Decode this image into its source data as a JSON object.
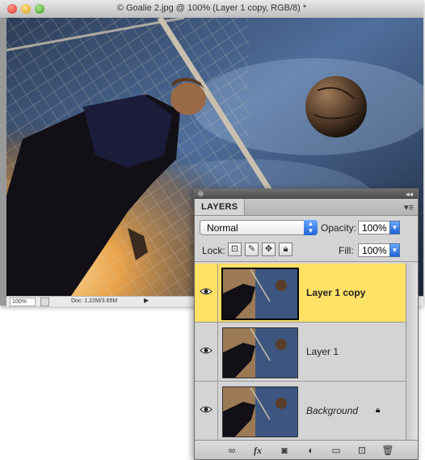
{
  "document": {
    "title": "© Goalie 2.jpg @ 100% (Layer 1 copy, RGB/8) *",
    "zoom": "100%",
    "doc_info": "Doc: 1.22M/3.65M"
  },
  "layers_panel": {
    "tab_label": "LAYERS",
    "blend_mode": "Normal",
    "opacity_label": "Opacity:",
    "opacity_value": "100%",
    "lock_label": "Lock:",
    "fill_label": "Fill:",
    "fill_value": "100%",
    "layers": [
      {
        "name": "Layer 1 copy",
        "selected": true,
        "visible": true
      },
      {
        "name": "Layer 1",
        "selected": false,
        "visible": true
      },
      {
        "name": "Background",
        "selected": false,
        "visible": true,
        "locked": true
      }
    ],
    "bottom_icons": [
      "link-icon",
      "fx-icon",
      "mask-icon",
      "adjustment-icon",
      "folder-icon",
      "new-layer-icon",
      "trash-icon"
    ]
  },
  "colors": {
    "selected_layer": "#ffe166",
    "accent_blue": "#1f63d6"
  }
}
